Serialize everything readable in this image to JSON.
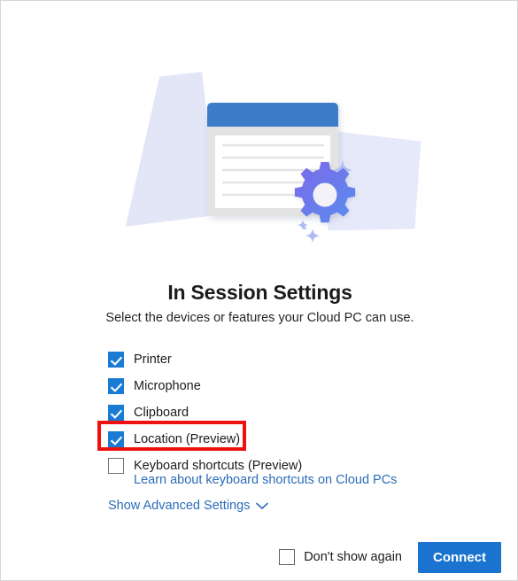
{
  "dialog": {
    "title": "In Session Settings",
    "subtitle": "Select the devices or features your Cloud PC can use."
  },
  "options": [
    {
      "label": "Printer",
      "checked": true
    },
    {
      "label": "Microphone",
      "checked": true
    },
    {
      "label": "Clipboard",
      "checked": true
    },
    {
      "label": "Location (Preview)",
      "checked": true
    },
    {
      "label": "Keyboard shortcuts (Preview)",
      "checked": false
    }
  ],
  "links": {
    "keyboard_shortcuts": "Learn about keyboard shortcuts on Cloud PCs",
    "advanced_settings": "Show Advanced Settings",
    "advanced_settings_icon": "chevron-down-icon"
  },
  "footer": {
    "dont_show_again_label": "Don't show again",
    "dont_show_again_checked": false,
    "connect_label": "Connect"
  },
  "annotation": {
    "type": "highlight-rectangle",
    "target": "Location (Preview)",
    "color": "#ee1111"
  },
  "colors": {
    "accent_blue": "#1a73cf",
    "checkbox_blue": "#1a7bd4",
    "link_blue": "#2b6cb8",
    "illustration_lavender": "#e2e6f7",
    "illustration_titlebar": "#3d7cc9",
    "gear_purple": "#7b68e8",
    "gear_blue": "#5b8def",
    "annotation_red": "#ee1111"
  },
  "illustration": {
    "name": "session-settings-illustration",
    "parts": [
      "lavender-sheet-left",
      "lavender-sheet-right",
      "document-window",
      "gear-icon",
      "sparkles"
    ]
  }
}
